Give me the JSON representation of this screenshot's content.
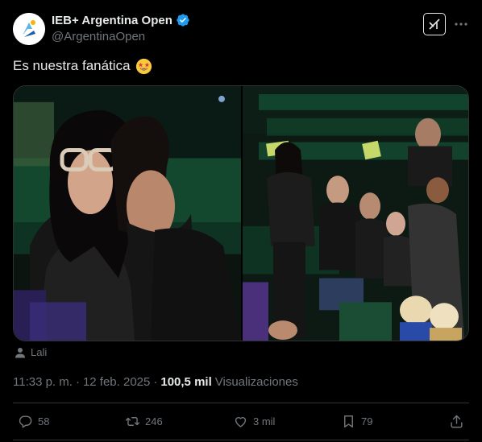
{
  "author": {
    "display_name": "IEB+ Argentina Open",
    "handle": "@ArgentinaOpen",
    "verified": true,
    "avatar_icon": "argentina-open-logo-icon",
    "verified_color": "#1d9bf0"
  },
  "tweet": {
    "text": "Es nuestra fanática",
    "emoji_icon": "star-struck-emoji-icon"
  },
  "media": {
    "count": 2
  },
  "tagged": {
    "icon": "person-icon",
    "name": "Lali"
  },
  "meta": {
    "time": "11:33 p. m.",
    "separator": "·",
    "date": "12 feb. 2025",
    "views_count": "100,5 mil",
    "views_label": "Visualizaciones"
  },
  "actions": {
    "replies": "58",
    "reposts": "246",
    "likes": "3 mil",
    "bookmarks": "79"
  },
  "colors": {
    "background": "#000000",
    "text": "#e7e9ea",
    "muted": "#71767b",
    "border": "#2f3336",
    "accent": "#1d9bf0"
  }
}
